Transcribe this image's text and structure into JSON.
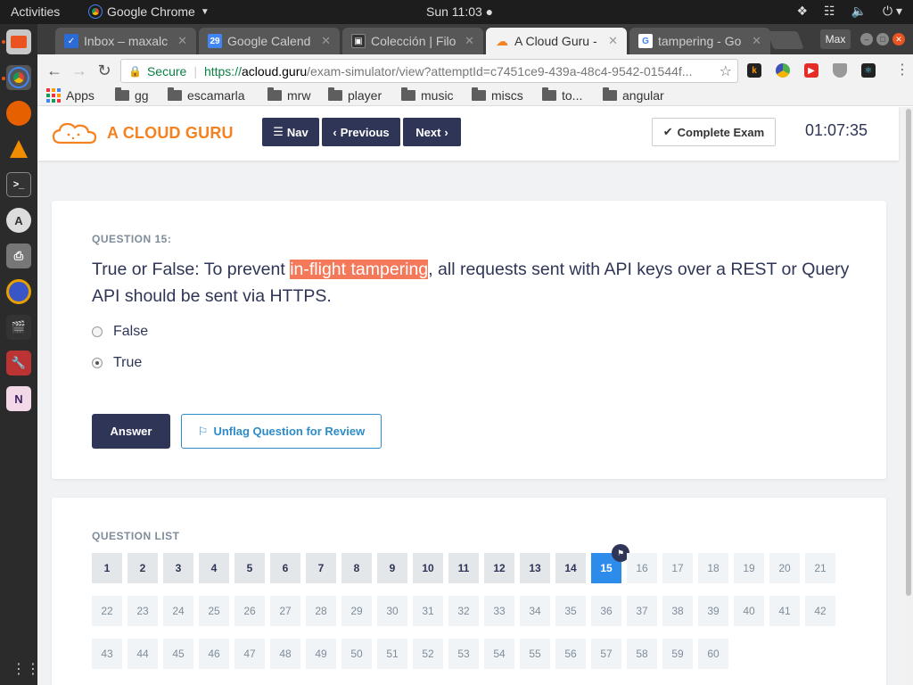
{
  "system": {
    "activities": "Activities",
    "app_name": "Google Chrome",
    "clock": "Sun 11:03 ●"
  },
  "dock": {
    "items": [
      "chrome",
      "firefox",
      "vlc",
      "terminal",
      "software-updater",
      "printer",
      "gnome-software",
      "video-editor",
      "settings",
      "archive"
    ]
  },
  "browser": {
    "tabs": [
      {
        "title": "Inbox – maxalc",
        "icon": "inbox-icon",
        "color": "#2b6bd6"
      },
      {
        "title": "Google Calend",
        "icon": "calendar-icon",
        "color": "#4285f4",
        "badge": "29"
      },
      {
        "title": "Colección | Filo",
        "icon": "film-icon",
        "color": "#333333"
      },
      {
        "title": "A Cloud Guru -",
        "icon": "cloud-icon",
        "color": "#f58220",
        "active": true
      },
      {
        "title": "tampering - Go",
        "icon": "google-icon",
        "color": "#4285f4"
      }
    ],
    "user_label": "Max",
    "omnibox": {
      "secure_label": "Secure",
      "scheme": "https://",
      "host": "acloud.guru",
      "path": "/exam-simulator/view?attemptId=c7451ce9-439a-48c4-9542-01544f..."
    },
    "extensions": [
      {
        "name": "k-icon",
        "label": "k",
        "color": "#222222"
      },
      {
        "name": "color-icon",
        "label": "",
        "color": "#4caf50"
      },
      {
        "name": "youtube-icon",
        "label": "▶",
        "color": "#e52d27"
      },
      {
        "name": "shield-icon",
        "label": "",
        "color": "#999999"
      },
      {
        "name": "react-icon",
        "label": "⚛",
        "color": "#222222"
      }
    ],
    "bookmarks": [
      {
        "label": "Apps",
        "type": "apps"
      },
      {
        "label": "gg",
        "type": "folder"
      },
      {
        "label": "escamarla",
        "type": "folder"
      },
      {
        "label": "mrw",
        "type": "folder"
      },
      {
        "label": "player",
        "type": "folder"
      },
      {
        "label": "music",
        "type": "folder"
      },
      {
        "label": "miscs",
        "type": "folder"
      },
      {
        "label": "to...",
        "type": "folder"
      },
      {
        "label": "angular",
        "type": "folder"
      }
    ]
  },
  "app": {
    "brand": "A CLOUD GURU",
    "brand_color": "#f58220",
    "nav_label": "Nav",
    "prev_label": "Previous",
    "next_label": "Next",
    "complete_label": "Complete Exam",
    "timer": "01:07:35"
  },
  "question": {
    "label": "QUESTION 15:",
    "text_before": "True or False: To prevent ",
    "text_highlight": "in-flight tampering",
    "text_after": ", all requests sent with API keys over a REST or Query API should be sent via HTTPS.",
    "options": [
      {
        "label": "False",
        "checked": false
      },
      {
        "label": "True",
        "checked": true
      }
    ],
    "answer_label": "Answer",
    "flag_label": "Unflag Question for Review"
  },
  "question_list": {
    "label": "QUESTION LIST",
    "total": 60,
    "answered_through": 14,
    "current": 15,
    "flagged": [
      15
    ]
  }
}
